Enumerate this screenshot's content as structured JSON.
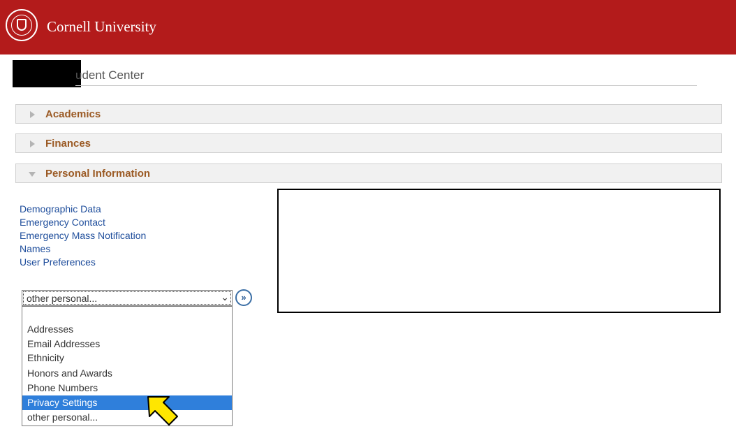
{
  "header": {
    "brand": "Cornell University",
    "background": "#b31b1b"
  },
  "page": {
    "title": "udent Center"
  },
  "sections": [
    {
      "label": "Academics",
      "state": "collapsed"
    },
    {
      "label": "Finances",
      "state": "collapsed"
    },
    {
      "label": "Personal Information",
      "state": "expanded"
    }
  ],
  "personal_links": [
    "Demographic Data",
    "Emergency Contact",
    "Emergency Mass Notification",
    "Names",
    "User Preferences"
  ],
  "select": {
    "value": "other personal...",
    "options": [
      "Addresses",
      "Email Addresses",
      "Ethnicity",
      "Honors and Awards",
      "Phone Numbers",
      "Privacy Settings",
      "other personal..."
    ],
    "highlighted": "Privacy Settings",
    "highlight_color": "#2f7fdb"
  },
  "go_button": {
    "label": "»"
  },
  "colors": {
    "link": "#1f4e9c",
    "section_label": "#9b5a24",
    "pointer": "#ffe600"
  }
}
